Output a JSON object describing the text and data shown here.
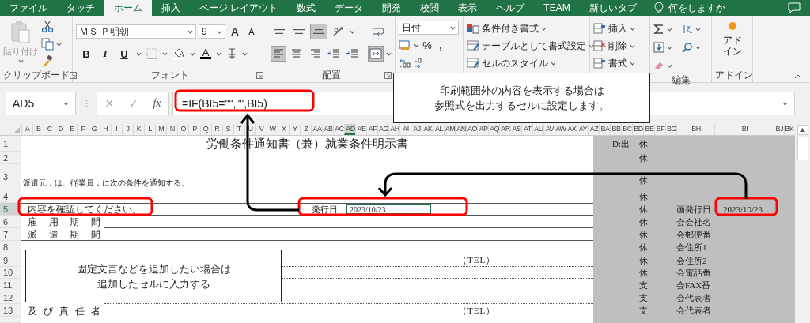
{
  "tabs": [
    {
      "label": "ファイル",
      "selected": false
    },
    {
      "label": "タッチ",
      "selected": false
    },
    {
      "label": "ホーム",
      "selected": true
    },
    {
      "label": "挿入",
      "selected": false
    },
    {
      "label": "ページ レイアウト",
      "selected": false
    },
    {
      "label": "数式",
      "selected": false
    },
    {
      "label": "データ",
      "selected": false
    },
    {
      "label": "開発",
      "selected": false
    },
    {
      "label": "校閲",
      "selected": false
    },
    {
      "label": "表示",
      "selected": false
    },
    {
      "label": "ヘルプ",
      "selected": false
    },
    {
      "label": "TEAM",
      "selected": false
    },
    {
      "label": "新しいタブ",
      "selected": false
    }
  ],
  "tell_me": "何をしますか",
  "clipboard": {
    "paste": "貼り付け",
    "label": "クリップボード"
  },
  "font": {
    "name": "ＭＳ Ｐ明朝",
    "size": "9",
    "grow": "A",
    "shrink": "A",
    "bold": "B",
    "italic": "I",
    "underline": "U",
    "color_letter": "A",
    "label": "フォント"
  },
  "alignment": {
    "label": "配置",
    "buttons": [
      {
        "kind": "top",
        "selected": false
      },
      {
        "kind": "middle",
        "selected": false
      },
      {
        "kind": "bottom",
        "selected": true
      },
      {
        "kind": "orientation",
        "selected": false
      },
      {
        "kind": "wrap",
        "selected": false
      },
      {
        "kind": "left",
        "selected": true
      },
      {
        "kind": "center",
        "selected": false
      },
      {
        "kind": "right",
        "selected": false
      },
      {
        "kind": "outdent",
        "selected": false
      },
      {
        "kind": "indent",
        "selected": false
      },
      {
        "kind": "merge",
        "selected": true
      }
    ]
  },
  "number": {
    "format": "日付",
    "percent": "%",
    "comma": ","
  },
  "styles": [
    "条件付き書式",
    "テーブルとして書式設定",
    "セルのスタイル"
  ],
  "cells": [
    "挿入",
    "削除",
    "書式"
  ],
  "editing": {
    "label": "編集"
  },
  "addins": {
    "button": [
      "アド",
      "イン"
    ],
    "label": "アドイン"
  },
  "formula_bar": {
    "name_box": "AD5",
    "cancel": "✕",
    "enter": "✓",
    "function": "fx",
    "formula": "=IF(BI5=\"\",\"\",BI5)"
  },
  "columns": [
    {
      "name": "A",
      "selected": false
    },
    {
      "name": "B",
      "selected": false
    },
    {
      "name": "C",
      "selected": false
    },
    {
      "name": "D",
      "selected": false
    },
    {
      "name": "E",
      "selected": false
    },
    {
      "name": "F",
      "selected": false
    },
    {
      "name": "G",
      "selected": false
    },
    {
      "name": "H",
      "selected": false
    },
    {
      "name": "I",
      "selected": false
    },
    {
      "name": "J",
      "selected": false
    },
    {
      "name": "K",
      "selected": false
    },
    {
      "name": "L",
      "selected": false
    },
    {
      "name": "M",
      "selected": false
    },
    {
      "name": "N",
      "selected": false
    },
    {
      "name": "O",
      "selected": false
    },
    {
      "name": "P",
      "selected": false
    },
    {
      "name": "Q",
      "selected": false
    },
    {
      "name": "R",
      "selected": false
    },
    {
      "name": "S",
      "selected": false
    },
    {
      "name": "T",
      "selected": false
    },
    {
      "name": "U",
      "selected": false
    },
    {
      "name": "V",
      "selected": false
    },
    {
      "name": "W",
      "selected": false
    },
    {
      "name": "X",
      "selected": false
    },
    {
      "name": "Y",
      "selected": false
    },
    {
      "name": "Z",
      "selected": false
    },
    {
      "name": "AA",
      "selected": false
    },
    {
      "name": "AB",
      "selected": false
    },
    {
      "name": "AC",
      "selected": false
    },
    {
      "name": "AD",
      "selected": true
    },
    {
      "name": "AE",
      "selected": false
    },
    {
      "name": "AF",
      "selected": false
    },
    {
      "name": "AG",
      "selected": false
    },
    {
      "name": "AH",
      "selected": false
    },
    {
      "name": "AI",
      "selected": false
    },
    {
      "name": "AJ",
      "selected": false
    },
    {
      "name": "AK",
      "selected": false
    },
    {
      "name": "AL",
      "selected": false
    },
    {
      "name": "AM",
      "selected": false
    },
    {
      "name": "AN",
      "selected": false
    },
    {
      "name": "AO",
      "selected": false
    },
    {
      "name": "AP",
      "selected": false
    },
    {
      "name": "AQ",
      "selected": false
    },
    {
      "name": "AR",
      "selected": false
    },
    {
      "name": "AS",
      "selected": false
    },
    {
      "name": "AT",
      "selected": false
    },
    {
      "name": "AU",
      "selected": false
    },
    {
      "name": "AV",
      "selected": false
    },
    {
      "name": "AW",
      "selected": false
    },
    {
      "name": "AX",
      "selected": false
    },
    {
      "name": "AY",
      "selected": false
    },
    {
      "name": "AZ",
      "selected": false
    },
    {
      "name": "BA",
      "selected": false
    },
    {
      "name": "BB",
      "selected": false
    },
    {
      "name": "BC",
      "selected": false
    },
    {
      "name": "BD",
      "selected": false
    },
    {
      "name": "BE",
      "selected": false
    },
    {
      "name": "BF",
      "selected": false
    },
    {
      "name": "BG",
      "selected": false
    },
    {
      "name": "BH",
      "selected": false
    },
    {
      "name": "BI",
      "selected": false
    },
    {
      "name": "BJ",
      "selected": false
    },
    {
      "name": "BK",
      "selected": false
    }
  ],
  "rows": [
    {
      "number": "1",
      "selected": false,
      "title": "労働条件通知書（兼）就業条件明示書",
      "d": "D:出",
      "flag": "休"
    },
    {
      "number": "2",
      "selected": false,
      "flag": "休"
    },
    {
      "number": "3",
      "selected": false,
      "text": "派遣元：は、従業員：に次の条件を通知する。",
      "flag": "休"
    },
    {
      "number": "4",
      "selected": false,
      "flag": "休"
    },
    {
      "number": "5",
      "selected": true,
      "note": "内容を確認してください。",
      "issue_label": "発行日",
      "issue_date": {
        "value": "2023/10/23",
        "selected": true
      },
      "flag": "休",
      "bh": "画発行日",
      "bi": "2023/10/23"
    },
    {
      "number": "6",
      "selected": false,
      "label": "雇 用 期 間",
      "flag": "休",
      "bh": "会会社名"
    },
    {
      "number": "7",
      "selected": false,
      "label": "派 遣 期 間",
      "flag": "休",
      "bh": "会郵便番"
    },
    {
      "number": "8",
      "selected": false,
      "flag": "休",
      "bh": "会住所1"
    },
    {
      "number": "9",
      "selected": false,
      "tel": "（TEL）",
      "flag": "休",
      "bh": "会住所2"
    },
    {
      "number": "10",
      "selected": false,
      "flag": "休",
      "bh": "会電話番"
    },
    {
      "number": "11",
      "selected": false,
      "flag": "支",
      "bh": "会FAX番"
    },
    {
      "number": "12",
      "selected": false,
      "flag": "支",
      "bh": "会代表者"
    },
    {
      "number": "13",
      "selected": false,
      "label": "及 び 責 任 者",
      "tel": "（TEL）",
      "flag": "支",
      "bh": "会代表者"
    }
  ],
  "callouts": [
    {
      "lines": [
        "印刷範囲外の内容を表示する場合は",
        "参照式を出力するセルに設定します。"
      ]
    },
    {
      "lines": [
        "固定文言などを追加したい場合は",
        "追加したセルに入力する"
      ]
    }
  ]
}
